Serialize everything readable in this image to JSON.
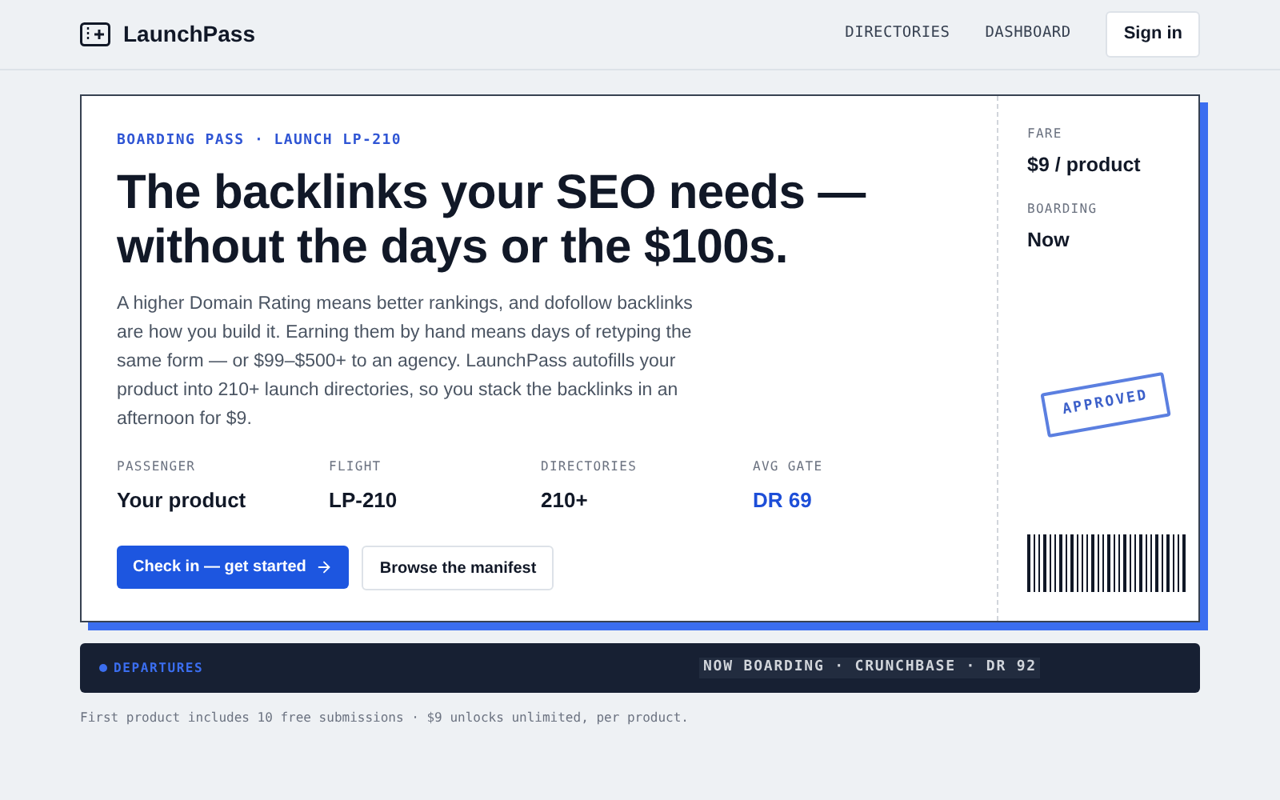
{
  "header": {
    "brand": "LaunchPass",
    "nav": [
      {
        "label": "DIRECTORIES"
      },
      {
        "label": "DASHBOARD"
      }
    ],
    "sign_in": "Sign in"
  },
  "pass": {
    "eyebrow": "BOARDING PASS · LAUNCH LP-210",
    "headline": "The backlinks your SEO needs — without the days or the $100s.",
    "body": "A higher Domain Rating means better rankings, and dofollow backlinks are how you build it. Earning them by hand means days of retyping the same form — or $99–$500+ to an agency. LaunchPass autofills your product into 210+ launch directories, so you stack the backlinks in an afternoon for $9.",
    "fields": [
      {
        "label": "PASSENGER",
        "value": "Your product",
        "highlight": false
      },
      {
        "label": "FLIGHT",
        "value": "LP-210",
        "highlight": false
      },
      {
        "label": "DIRECTORIES",
        "value": "210+",
        "highlight": false
      },
      {
        "label": "AVG GATE",
        "value": "DR 69",
        "highlight": true
      }
    ],
    "primary_button": "Check in — get started",
    "secondary_button": "Browse the manifest"
  },
  "stub": {
    "fields": [
      {
        "label": "FARE",
        "value": "$9 / product"
      },
      {
        "label": "BOARDING",
        "value": "Now"
      }
    ],
    "stamp": "APPROVED"
  },
  "departures": {
    "label": "DEPARTURES",
    "ticker": "NOW BOARDING · CRUNCHBASE · DR 92"
  },
  "footnote": "First product includes 10 free submissions · $9 unlocks unlimited, per product."
}
